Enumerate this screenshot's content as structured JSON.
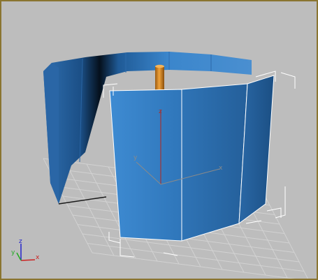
{
  "viewport": {
    "view_label": "",
    "colors": {
      "background": "#bdbdbd",
      "border": "#8a7530",
      "grid": "#d0d0d0",
      "object_blue": "#3a7fc2",
      "object_dark": "#0a1c30",
      "selection_bracket": "#ffffff",
      "pivot_orange": "#d38a1f"
    }
  },
  "gizmo": {
    "z_label": "z",
    "y_label": "y",
    "x_label": "x",
    "x_color": "#cc2222",
    "y_color": "#22aa22",
    "z_color": "#2222cc"
  },
  "transform_gizmo": {
    "x_label": "x",
    "y_label": "y",
    "z_label": "z"
  }
}
